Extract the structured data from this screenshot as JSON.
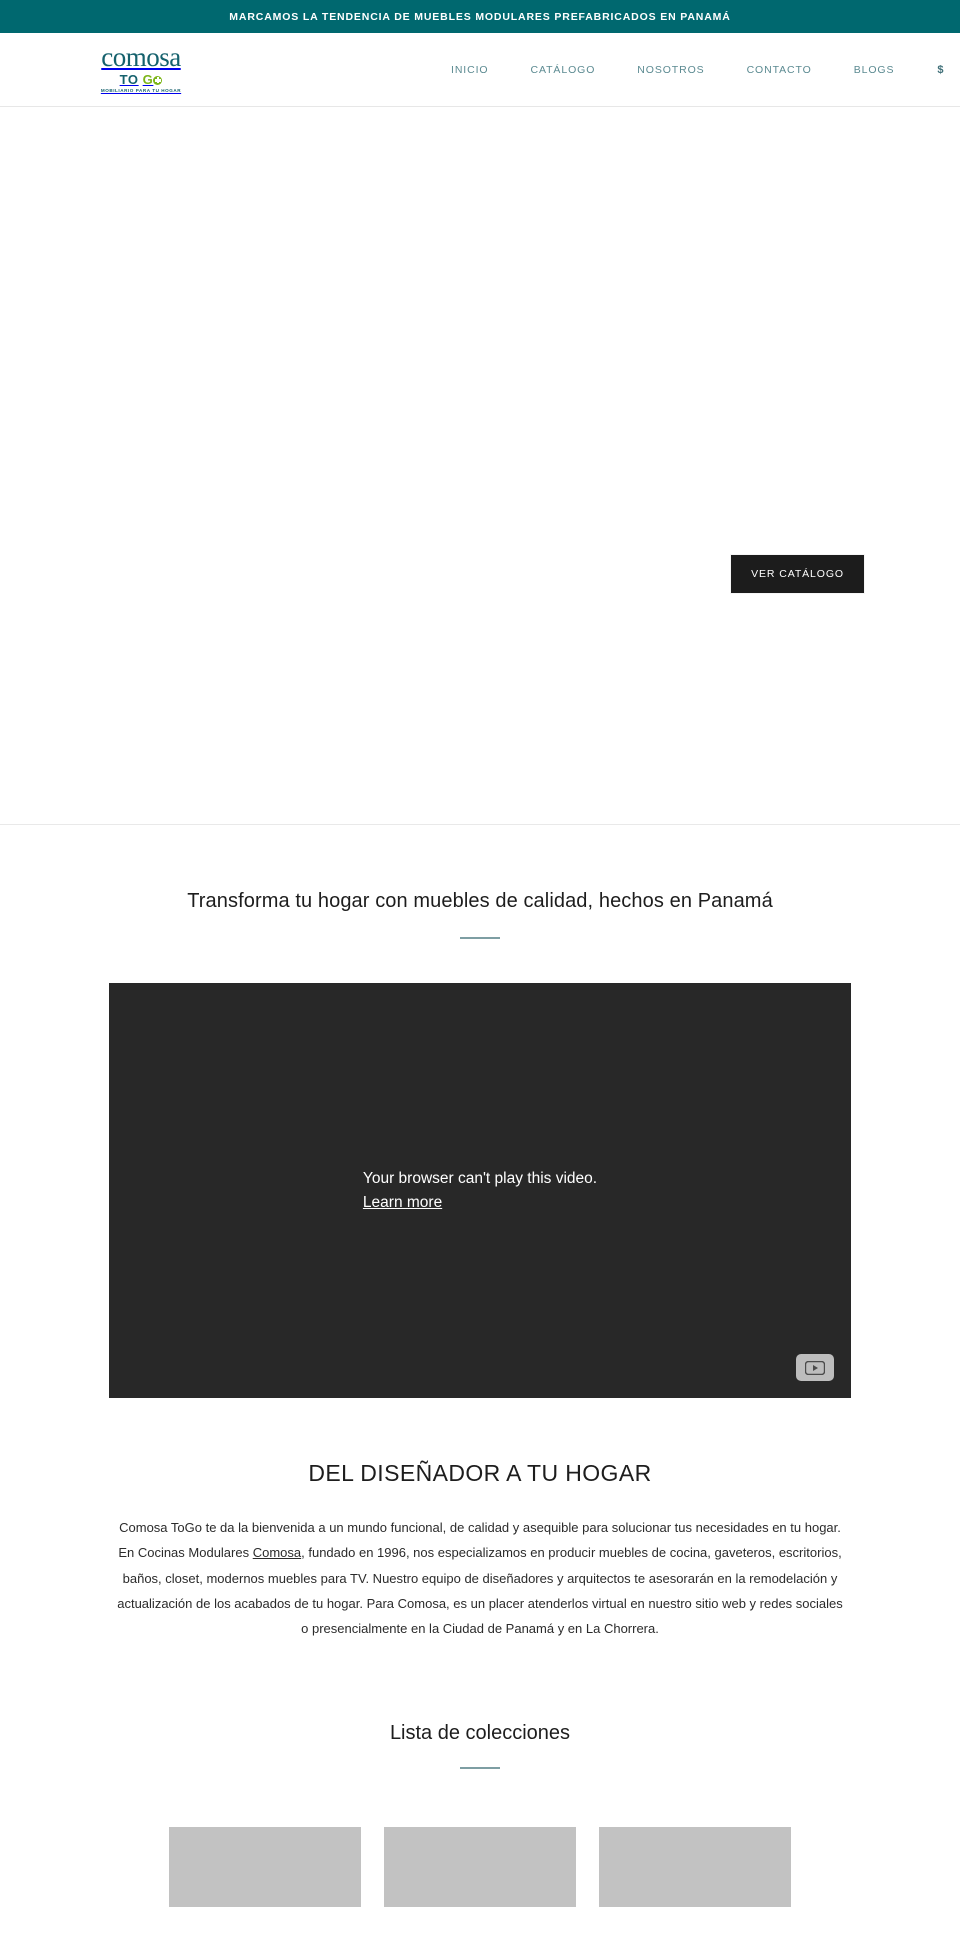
{
  "announcement": {
    "text": "MARCAMOS LA TENDENCIA DE MUEBLES MODULARES PREFABRICADOS EN PANAMÁ"
  },
  "header": {
    "logo": {
      "wordmark": "comosa",
      "to": "TO",
      "go": "G",
      "tagline": "MOBILIARIO PARA TU HOGAR"
    },
    "nav": [
      {
        "label": "INICIO",
        "name": "nav-inicio"
      },
      {
        "label": "CATÁLOGO",
        "name": "nav-catalogo"
      },
      {
        "label": "NOSOTROS",
        "name": "nav-nosotros"
      },
      {
        "label": "CONTACTO",
        "name": "nav-contacto"
      },
      {
        "label": "BLOGS",
        "name": "nav-blogs"
      }
    ],
    "currency": "$"
  },
  "hero": {
    "cta_label": "VER CATÁLOGO"
  },
  "intro": {
    "title": "Transforma tu hogar con muebles de calidad, hechos en Panamá"
  },
  "video": {
    "error_message": "Your browser can't play this video.",
    "learn_more": "Learn more",
    "play_icon": "youtube-play-icon"
  },
  "designer": {
    "title": "DEL DISEÑADOR A TU HOGAR",
    "paragraph_part1": "Comosa ToGo te da la bienvenida a un mundo funcional, de calidad y asequible para solucionar tus necesidades en tu hogar. En Cocinas Modulares ",
    "link_text": "Comosa",
    "paragraph_part2": ", fundado en 1996, nos especializamos en producir muebles de cocina, gaveteros, escritorios, baños, closet, modernos muebles para TV. Nuestro equipo de diseñadores y arquitectos te asesorarán en la remodelación y actualización de los acabados de tu hogar. Para Comosa, es un placer atenderlos virtual en nuestro sitio web y redes sociales o presencialmente en la Ciudad de Panamá y en La Chorrera."
  },
  "collections": {
    "title": "Lista de colecciones",
    "cards": [
      {
        "name": "collection-card-1"
      },
      {
        "name": "collection-card-2"
      },
      {
        "name": "collection-card-3"
      }
    ]
  },
  "colors": {
    "announcement_bg": "#00686f",
    "brand_teal": "#15616d",
    "brand_green": "#7cb518",
    "nav_text": "#5b8a91",
    "cta_bg": "#1c1c1c",
    "video_bg": "#282828",
    "card_placeholder": "#c2c2c2",
    "rule": "#7e9ea3"
  }
}
